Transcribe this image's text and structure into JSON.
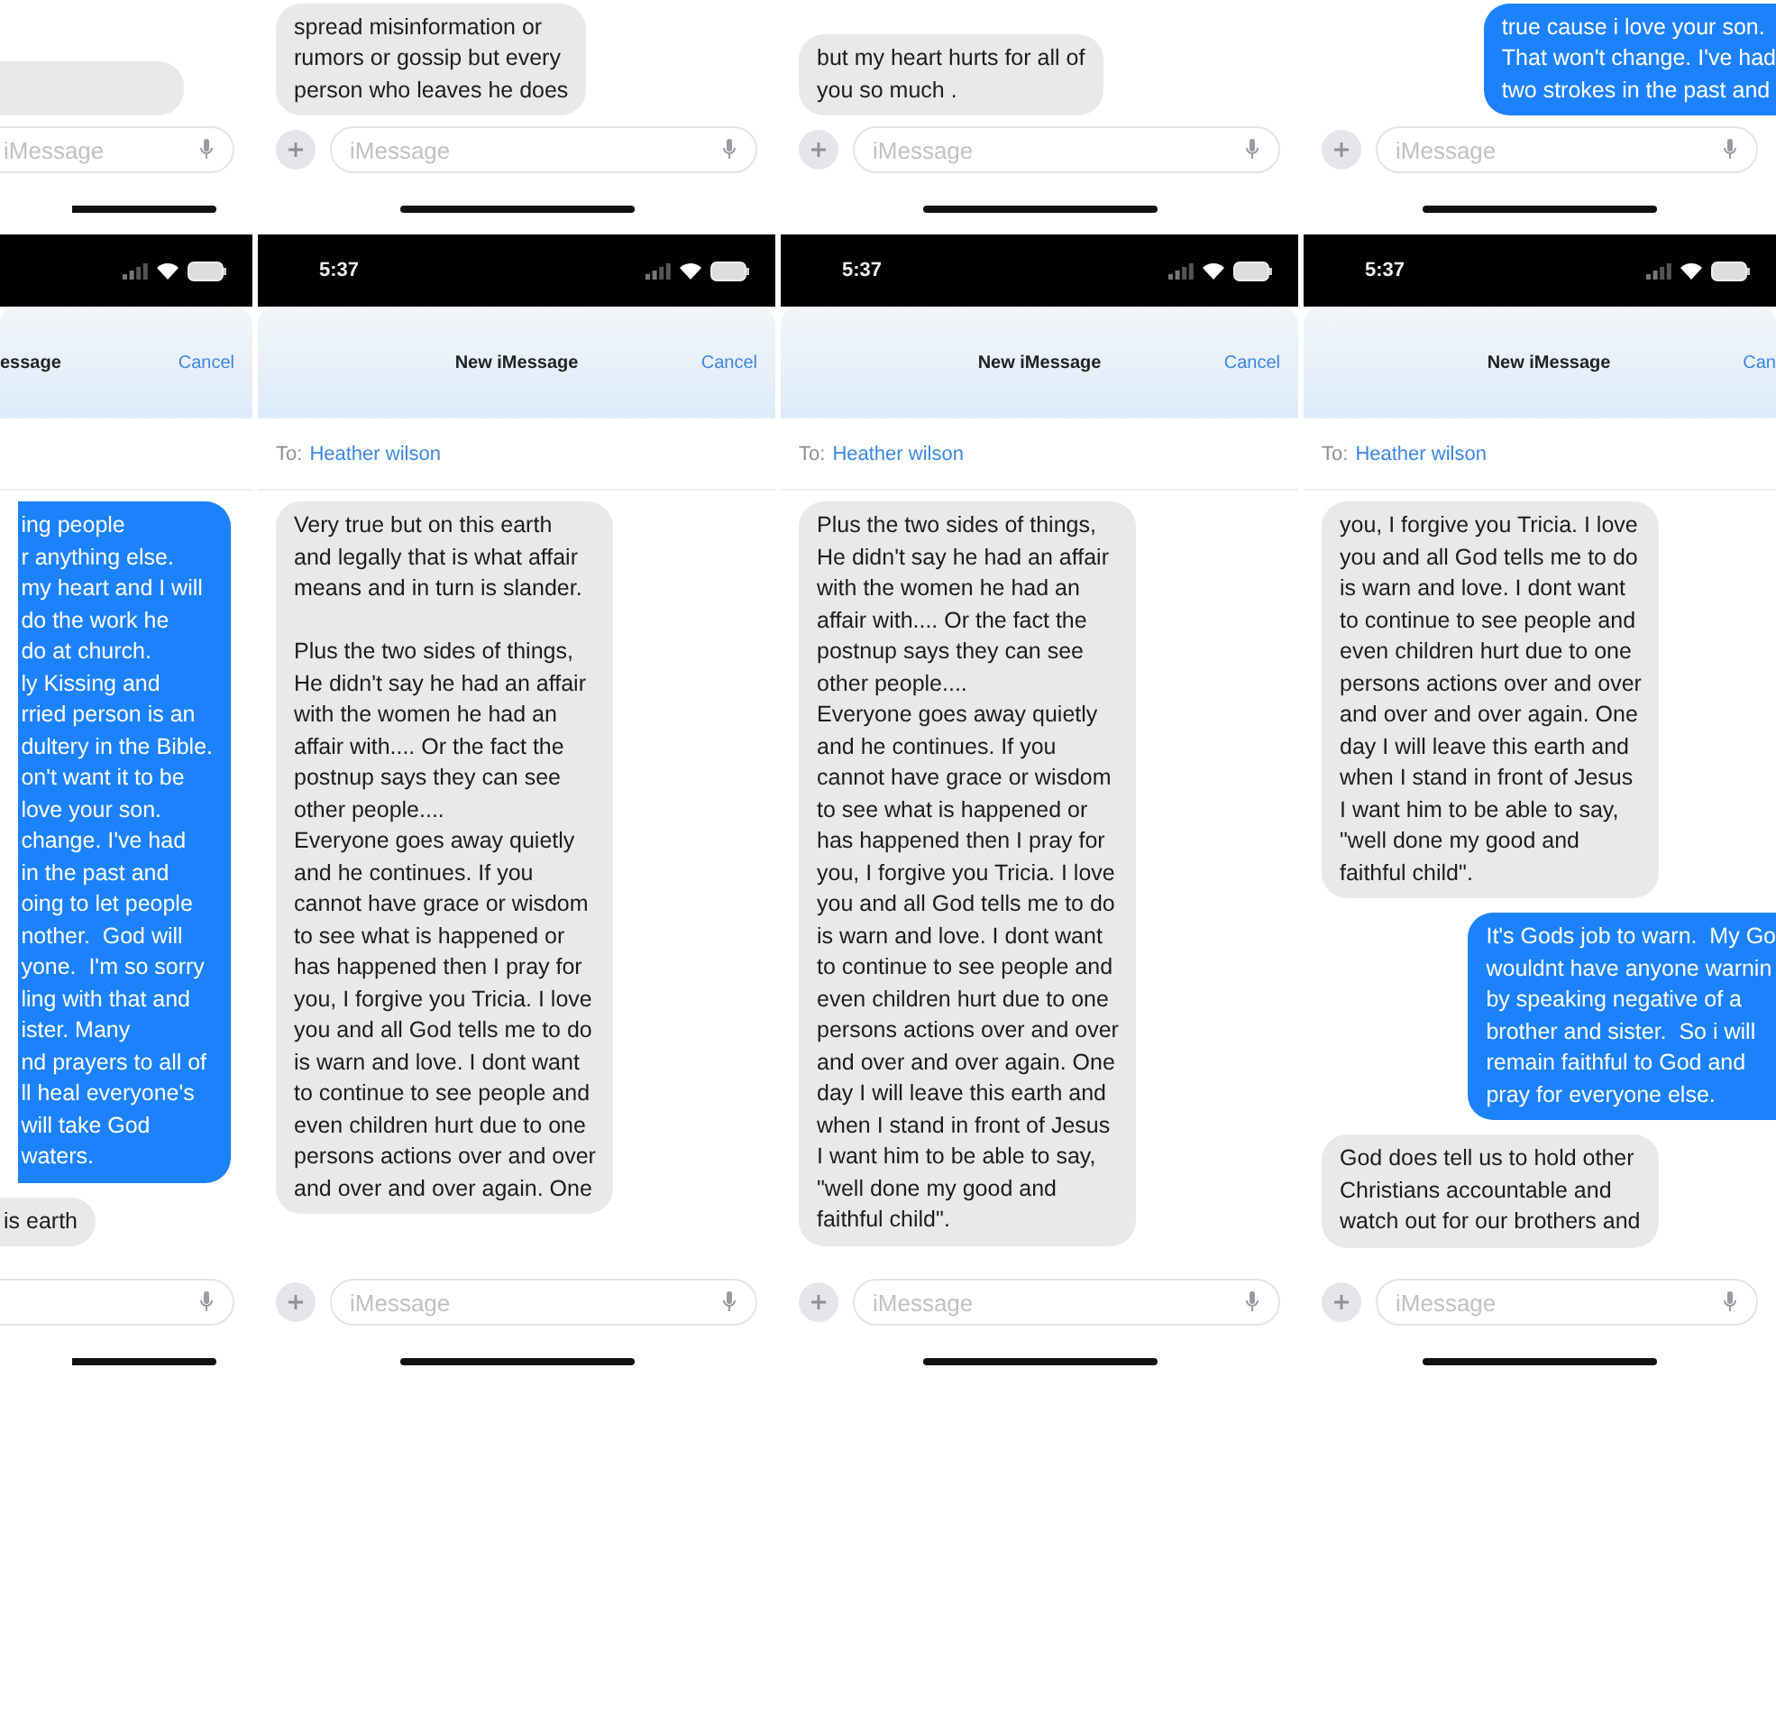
{
  "top_row": [
    {
      "messages": [
        {
          "kind": "received"
        }
      ],
      "input_placeholder": "iMessage"
    },
    {
      "messages": [
        {
          "kind": "received",
          "text": "spread misinformation or\nrumors or gossip but every\nperson who leaves he does"
        }
      ],
      "input_placeholder": "iMessage"
    },
    {
      "messages": [
        {
          "kind": "received",
          "text": "but my heart hurts for all of\nyou so much ."
        }
      ],
      "input_placeholder": "iMessage"
    },
    {
      "messages": [
        {
          "kind": "sent",
          "text": "true cause i love your son.\nThat won't change. I've had\ntwo strokes in the past and"
        }
      ],
      "input_placeholder": "iMessage"
    }
  ],
  "bottom_row": [
    {
      "sheet_title": "essage",
      "cancel": "Cancel",
      "messages": [
        {
          "kind": "sent",
          "text": "ing people\nr anything else.\nmy heart and I will\ndo the work he\ndo at church.\nly Kissing and\nrried person is an\ndultery in the Bible.\non't want it to be\nlove your son.\nchange. I've had\nin the past and\noing to let people\nnother.  God will\nyone.  I'm so sorry\nling with that and\nister. Many\nnd prayers to all of\nll heal everyone's\nwill take God\nwaters."
        },
        {
          "kind": "received",
          "text": "is earth"
        }
      ]
    },
    {
      "time": "5:37",
      "sheet_title": "New iMessage",
      "cancel": "Cancel",
      "to_label": "To:",
      "recipient": "Heather wilson",
      "messages": [
        {
          "kind": "received",
          "text": "Very true but on this earth\nand legally that is what affair\nmeans and in turn is slander.\n\nPlus the two sides of things,\nHe didn't say he had an affair\nwith the women he had an\naffair with.... Or the fact the\npostnup says they can see\nother people....\nEveryone goes away quietly\nand he continues. If you\ncannot have grace or wisdom\nto see what is happened or\nhas happened then I pray for\nyou, I forgive you Tricia. I love\nyou and all God tells me to do\nis warn and love. I dont want\nto continue to see people and\neven children hurt due to one\npersons actions over and over\nand over and over again. One"
        }
      ],
      "input_placeholder": "iMessage"
    },
    {
      "time": "5:37",
      "sheet_title": "New iMessage",
      "cancel": "Cancel",
      "to_label": "To:",
      "recipient": "Heather wilson",
      "messages": [
        {
          "kind": "received",
          "text": "Plus the two sides of things,\nHe didn't say he had an affair\nwith the women he had an\naffair with.... Or the fact the\npostnup says they can see\nother people....\nEveryone goes away quietly\nand he continues. If you\ncannot have grace or wisdom\nto see what is happened or\nhas happened then I pray for\nyou, I forgive you Tricia. I love\nyou and all God tells me to do\nis warn and love. I dont want\nto continue to see people and\neven children hurt due to one\npersons actions over and over\nand over and over again. One\nday I will leave this earth and\nwhen I stand in front of Jesus\nI want him to be able to say,\n\"well done my good and\nfaithful child\"."
        }
      ],
      "input_placeholder": "iMessage"
    },
    {
      "time": "5:37",
      "sheet_title": "New iMessage",
      "cancel": "Can",
      "to_label": "To:",
      "recipient": "Heather wilson",
      "messages": [
        {
          "kind": "received",
          "text": "you, I forgive you Tricia. I love\nyou and all God tells me to do\nis warn and love. I dont want\nto continue to see people and\neven children hurt due to one\npersons actions over and over\nand over and over again. One\nday I will leave this earth and\nwhen I stand in front of Jesus\nI want him to be able to say,\n\"well done my good and\nfaithful child\"."
        },
        {
          "kind": "sent",
          "text": "It's Gods job to warn.  My Go\nwouldnt have anyone warnin\nby speaking negative of a\nbrother and sister.  So i will\nremain faithful to God and\npray for everyone else."
        },
        {
          "kind": "received",
          "text": "God does tell us to hold other\nChristians accountable and\nwatch out for our brothers and"
        }
      ],
      "input_placeholder": "iMessage"
    }
  ]
}
